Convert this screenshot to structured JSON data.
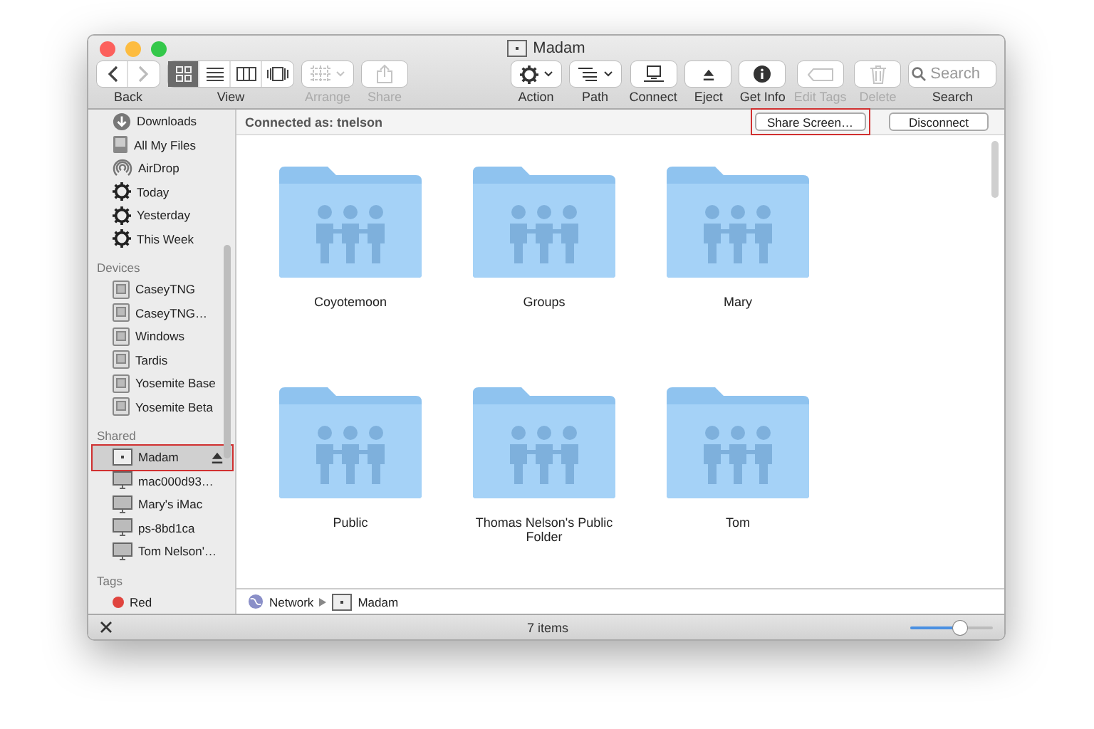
{
  "window": {
    "title": "Madam"
  },
  "toolbar": [
    {
      "kind": "nav",
      "label": "Back",
      "buttons": [
        {
          "disabled": false
        },
        {
          "disabled": true
        }
      ]
    },
    {
      "kind": "segmented",
      "label": "View",
      "options": [
        {
          "selected": true
        },
        {
          "selected": false
        },
        {
          "selected": false
        },
        {
          "selected": false
        }
      ]
    },
    {
      "kind": "arrange",
      "label": "Arrange",
      "disabled": true
    },
    {
      "kind": "share",
      "label": "Share",
      "disabled": true
    },
    {
      "kind": "spacer"
    },
    {
      "kind": "action",
      "label": "Action",
      "disabled": false
    },
    {
      "kind": "path",
      "label": "Path",
      "disabled": false
    },
    {
      "kind": "connect",
      "label": "Connect",
      "disabled": false
    },
    {
      "kind": "eject",
      "label": "Eject",
      "disabled": false
    },
    {
      "kind": "info",
      "label": "Get Info",
      "disabled": false
    },
    {
      "kind": "tags",
      "label": "Edit Tags",
      "disabled": true
    },
    {
      "kind": "delete",
      "label": "Delete",
      "disabled": true
    },
    {
      "kind": "search",
      "label": "Search",
      "placeholder": "Search"
    }
  ],
  "sidebar": {
    "sections": [
      {
        "items": [
          {
            "label": "Downloads",
            "kind": "download",
            "selected": false,
            "eject": false,
            "annotated": false
          },
          {
            "label": "All My Files",
            "kind": "files",
            "selected": false,
            "eject": false,
            "annotated": false
          },
          {
            "label": "AirDrop",
            "kind": "airdrop",
            "selected": false,
            "eject": false,
            "annotated": false
          },
          {
            "label": "Today",
            "kind": "smart",
            "selected": false,
            "eject": false,
            "annotated": false
          },
          {
            "label": "Yesterday",
            "kind": "smart",
            "selected": false,
            "eject": false,
            "annotated": false
          },
          {
            "label": "This Week",
            "kind": "smart",
            "selected": false,
            "eject": false,
            "annotated": false
          }
        ]
      },
      {
        "heading": "Devices",
        "items": [
          {
            "label": "CaseyTNG",
            "kind": "disk",
            "selected": false,
            "eject": false,
            "annotated": false
          },
          {
            "label": "CaseyTNG…",
            "kind": "disk",
            "selected": false,
            "eject": false,
            "annotated": false
          },
          {
            "label": "Windows",
            "kind": "disk",
            "selected": false,
            "eject": false,
            "annotated": false
          },
          {
            "label": "Tardis",
            "kind": "disk",
            "selected": false,
            "eject": false,
            "annotated": false
          },
          {
            "label": "Yosemite Base",
            "kind": "disk",
            "selected": false,
            "eject": false,
            "annotated": false
          },
          {
            "label": "Yosemite Beta",
            "kind": "disk",
            "selected": false,
            "eject": false,
            "annotated": false
          }
        ]
      },
      {
        "heading": "Shared",
        "items": [
          {
            "label": "Madam",
            "kind": "server",
            "selected": true,
            "eject": true,
            "annotated": true
          },
          {
            "label": "mac000d93…",
            "kind": "computer",
            "selected": false,
            "eject": false,
            "annotated": false
          },
          {
            "label": "Mary's iMac",
            "kind": "computer",
            "selected": false,
            "eject": false,
            "annotated": false
          },
          {
            "label": "ps-8bd1ca",
            "kind": "computer",
            "selected": false,
            "eject": false,
            "annotated": false
          },
          {
            "label": "Tom Nelson'…",
            "kind": "computer",
            "selected": false,
            "eject": false,
            "annotated": false
          }
        ]
      },
      {
        "heading": "Tags",
        "items": [
          {
            "label": "Red",
            "kind": "tag",
            "color": "#e0443e",
            "selected": false,
            "eject": false,
            "annotated": false
          }
        ]
      }
    ]
  },
  "connection": {
    "text": "Connected as: tnelson",
    "buttons": [
      {
        "label": "Share Screen…",
        "annotated": true
      },
      {
        "label": "Disconnect",
        "annotated": false
      }
    ]
  },
  "folders": [
    "Coyotemoon",
    "Groups",
    "Mary",
    "Public",
    "Thomas Nelson's Public Folder",
    "Tom"
  ],
  "path_bar": [
    "Network",
    "Madam"
  ],
  "status_bar": {
    "text": "7 items",
    "zoom": {
      "level": 0.6
    }
  }
}
